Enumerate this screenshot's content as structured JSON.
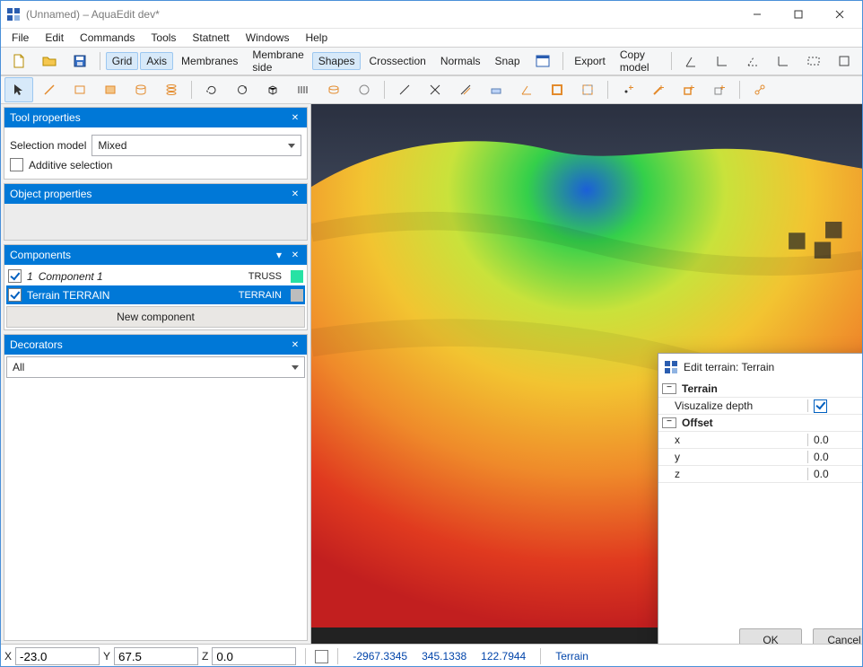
{
  "window": {
    "title": "(Unnamed) – AquaEdit dev*"
  },
  "menu": [
    "File",
    "Edit",
    "Commands",
    "Tools",
    "Statnett",
    "Windows",
    "Help"
  ],
  "toolbar1": {
    "toggles": [
      {
        "label": "Grid",
        "on": true
      },
      {
        "label": "Axis",
        "on": true
      },
      {
        "label": "Membranes",
        "on": false
      },
      {
        "label": "Membrane side",
        "on": false
      },
      {
        "label": "Shapes",
        "on": true
      },
      {
        "label": "Crossection",
        "on": false
      },
      {
        "label": "Normals",
        "on": false
      },
      {
        "label": "Snap",
        "on": false
      }
    ],
    "rightLabels": [
      "Export",
      "Copy model"
    ]
  },
  "panels": {
    "toolProps": {
      "title": "Tool properties",
      "selectionModelLabel": "Selection model",
      "selectionModelValue": "Mixed",
      "additiveLabel": "Additive selection"
    },
    "objectProps": {
      "title": "Object properties"
    },
    "components": {
      "title": "Components",
      "items": [
        {
          "checked": true,
          "idx": "1",
          "name": "Component 1",
          "type": "TRUSS",
          "color": "#27e2a4",
          "selected": false
        },
        {
          "checked": true,
          "idx": "",
          "name": "Terrain TERRAIN",
          "type": "TERRAIN",
          "color": "#bdbdbd",
          "selected": true
        }
      ],
      "newLabel": "New component"
    },
    "decorators": {
      "title": "Decorators",
      "filter": "All"
    }
  },
  "dialog": {
    "title": "Edit terrain: Terrain",
    "groups": [
      {
        "name": "Terrain",
        "rows": [
          {
            "label": "Visuzalize depth",
            "type": "check",
            "value": true
          }
        ]
      },
      {
        "name": "Offset",
        "rows": [
          {
            "label": "x",
            "type": "text",
            "value": "0.0"
          },
          {
            "label": "y",
            "type": "text",
            "value": "0.0"
          },
          {
            "label": "z",
            "type": "text",
            "value": "0.0"
          }
        ]
      }
    ],
    "ok": "OK",
    "cancel": "Cancel"
  },
  "status": {
    "xLabel": "X",
    "x": "-23.0",
    "yLabel": "Y",
    "y": "67.5",
    "zLabel": "Z",
    "z": "0.0",
    "vals": [
      "-2967.3345",
      "345.1338",
      "122.7944"
    ],
    "mode": "Terrain"
  },
  "colors": {
    "accent": "#0078d7"
  }
}
